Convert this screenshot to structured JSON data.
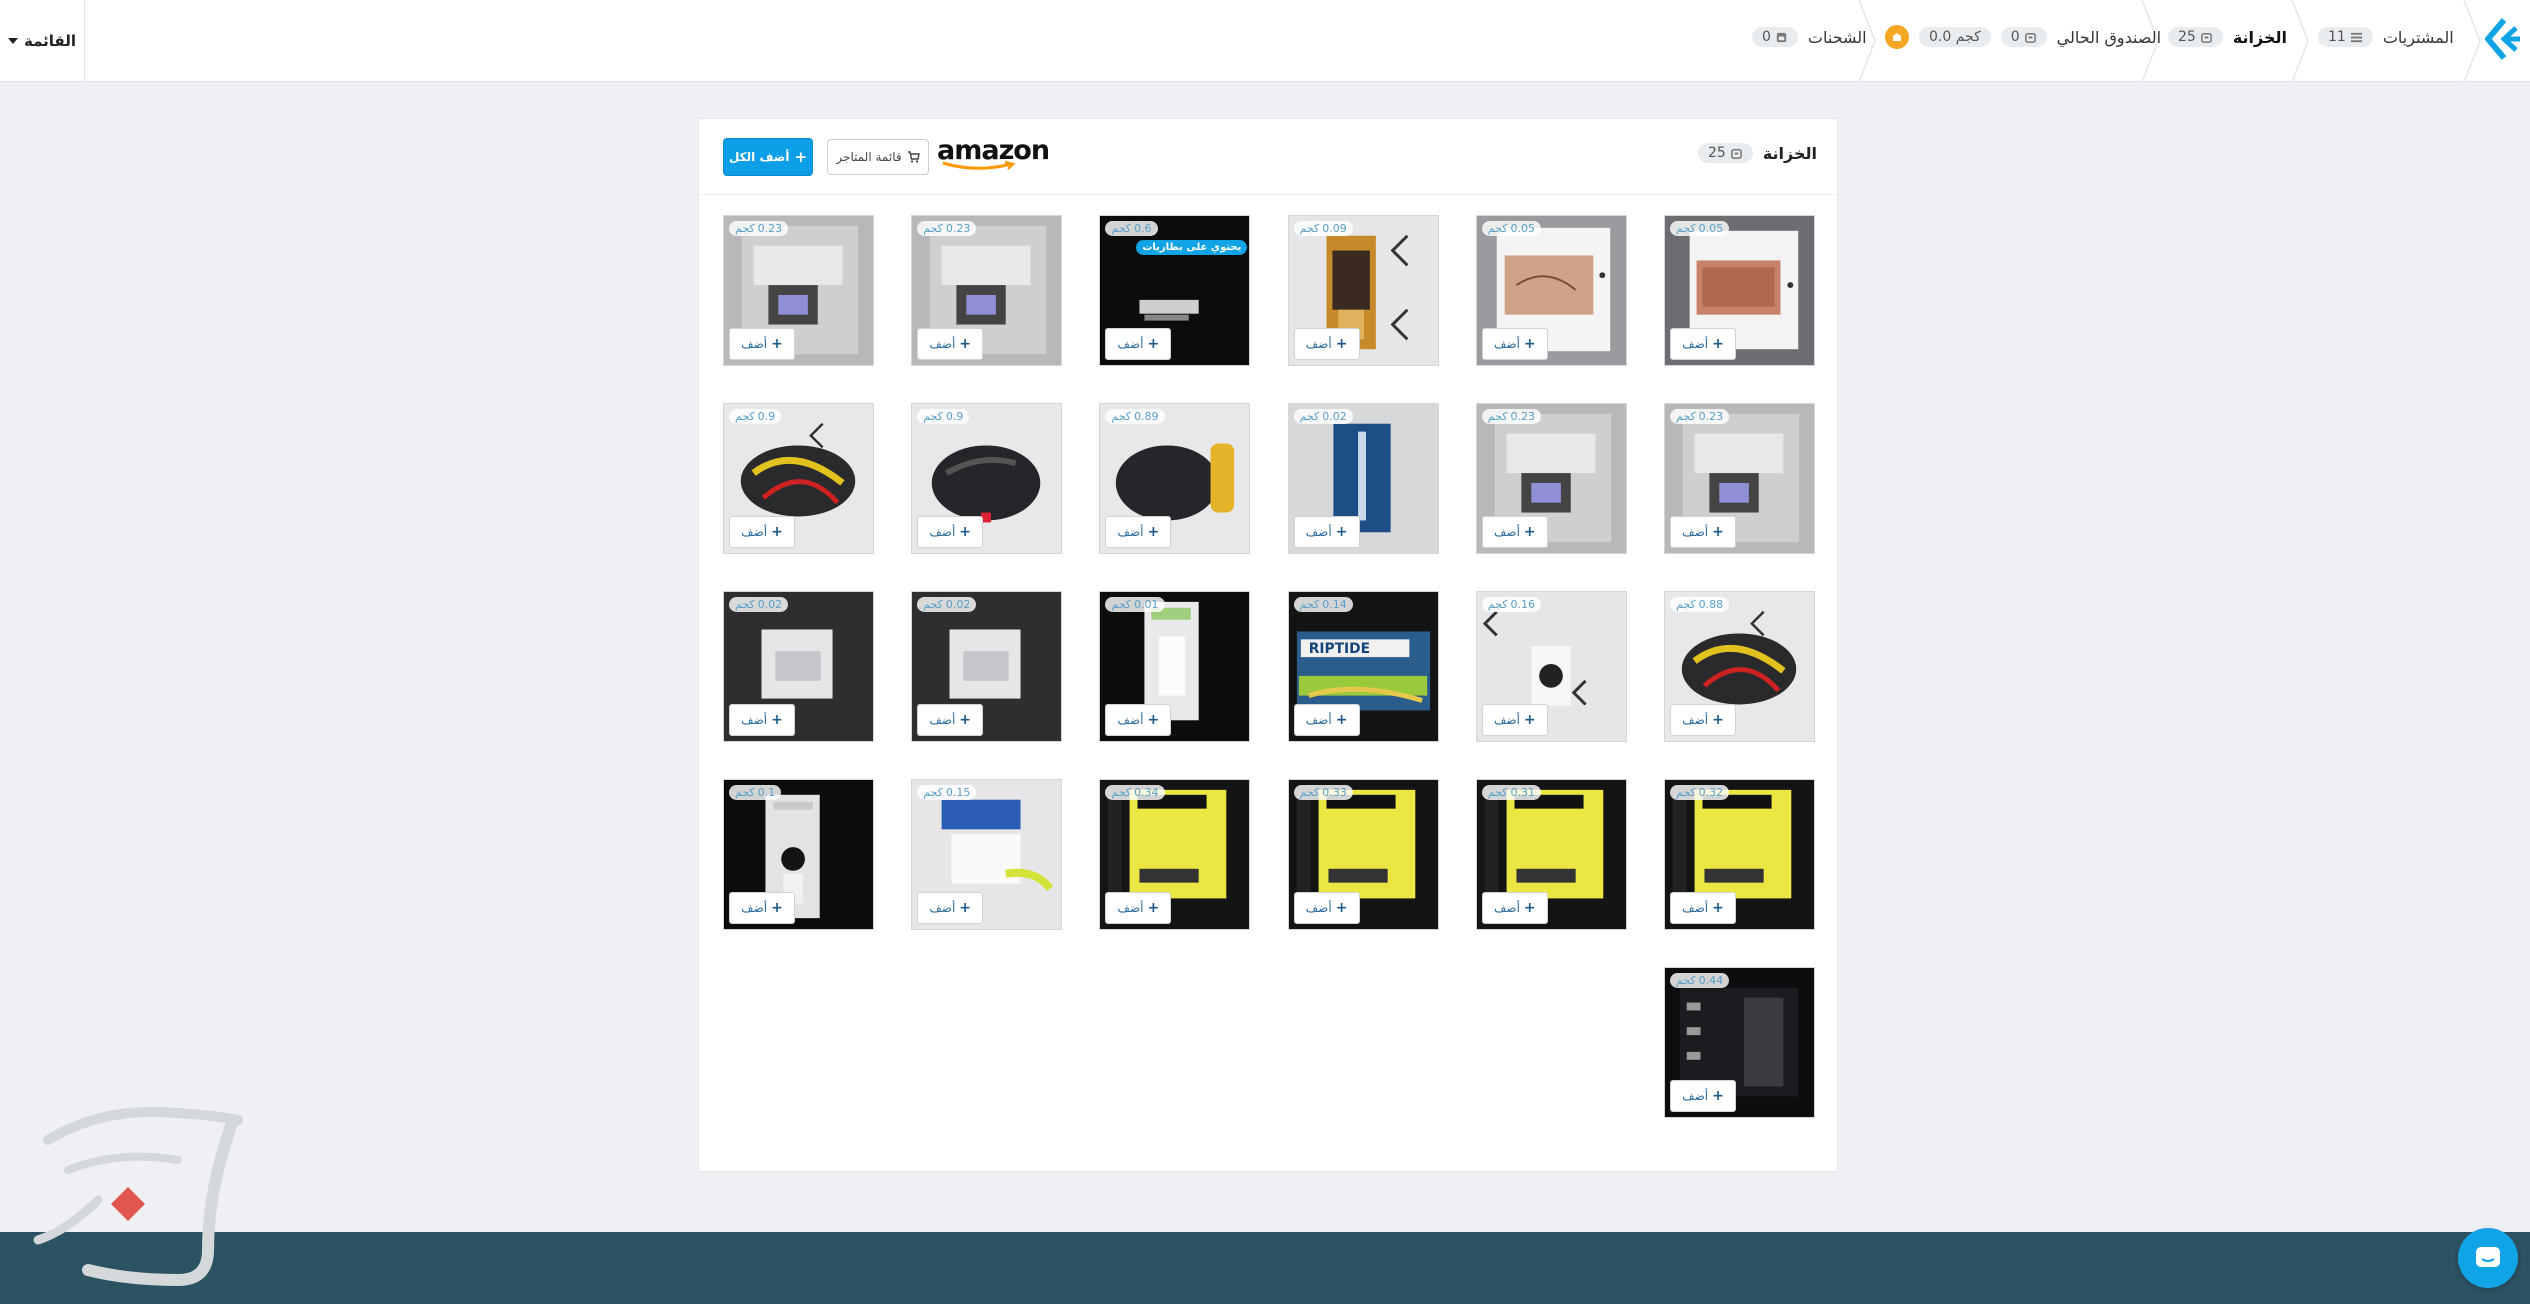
{
  "nav": {
    "menu_label": "القائمة",
    "purchases": {
      "label": "المشتريات",
      "count": "11"
    },
    "vault": {
      "label": "الخزانة",
      "count": "25"
    },
    "current_box": {
      "label": "الصندوق الحالي",
      "count": "0",
      "weight": "0.0 كجم"
    },
    "shipments": {
      "label": "الشحنات",
      "count": "0"
    }
  },
  "panel": {
    "title": "الخزانة",
    "count": "25",
    "store_logo": "amazon",
    "store_list_label": "قائمة المتاجر",
    "add_all_label": "أضف الكل"
  },
  "items": [
    {
      "weight": "0.05",
      "unit": "كجم",
      "add_label": "أضف"
    },
    {
      "weight": "0.05",
      "unit": "كجم",
      "add_label": "أضف"
    },
    {
      "weight": "0.09",
      "unit": "كجم",
      "add_label": "أضف"
    },
    {
      "weight": "0.6",
      "unit": "كجم",
      "add_label": "أضف",
      "tag": "يحتوي على بطاريات"
    },
    {
      "weight": "0.23",
      "unit": "كجم",
      "add_label": "أضف"
    },
    {
      "weight": "0.23",
      "unit": "كجم",
      "add_label": "أضف"
    },
    {
      "weight": "0.23",
      "unit": "كجم",
      "add_label": "أضف"
    },
    {
      "weight": "0.23",
      "unit": "كجم",
      "add_label": "أضف"
    },
    {
      "weight": "0.02",
      "unit": "كجم",
      "add_label": "أضف"
    },
    {
      "weight": "0.89",
      "unit": "كجم",
      "add_label": "أضف"
    },
    {
      "weight": "0.9",
      "unit": "كجم",
      "add_label": "أضف"
    },
    {
      "weight": "0.9",
      "unit": "كجم",
      "add_label": "أضف"
    },
    {
      "weight": "0.88",
      "unit": "كجم",
      "add_label": "أضف"
    },
    {
      "weight": "0.16",
      "unit": "كجم",
      "add_label": "أضف"
    },
    {
      "weight": "0.14",
      "unit": "كجم",
      "add_label": "أضف"
    },
    {
      "weight": "0.01",
      "unit": "كجم",
      "add_label": "أضف"
    },
    {
      "weight": "0.02",
      "unit": "كجم",
      "add_label": "أضف"
    },
    {
      "weight": "0.02",
      "unit": "كجم",
      "add_label": "أضف"
    },
    {
      "weight": "0.32",
      "unit": "كجم",
      "add_label": "أضف"
    },
    {
      "weight": "0.31",
      "unit": "كجم",
      "add_label": "أضف"
    },
    {
      "weight": "0.33",
      "unit": "كجم",
      "add_label": "أضف"
    },
    {
      "weight": "0.34",
      "unit": "كجم",
      "add_label": "أضف"
    },
    {
      "weight": "0.15",
      "unit": "كجم",
      "add_label": "أضف"
    },
    {
      "weight": "0.1",
      "unit": "كجم",
      "add_label": "أضف"
    },
    {
      "weight": "0.44",
      "unit": "كجم",
      "add_label": "أضف"
    }
  ],
  "colors": {
    "accent": "#10a3e6",
    "footer": "#2b5361",
    "coin": "#f5a623"
  }
}
